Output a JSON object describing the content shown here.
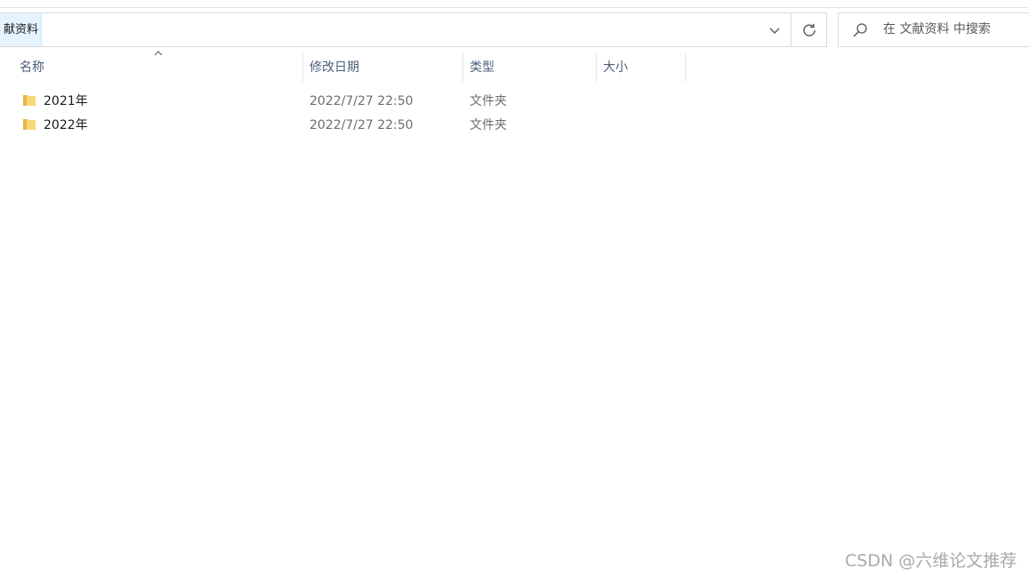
{
  "address_bar": {
    "crumb": "献资料",
    "dropdown_icon": "chevron-down-icon",
    "refresh_icon": "refresh-icon"
  },
  "search": {
    "placeholder": "在 文献资料 中搜索",
    "icon": "search-icon"
  },
  "columns": {
    "name": "名称",
    "date_modified": "修改日期",
    "type": "类型",
    "size": "大小"
  },
  "files": [
    {
      "name": "2021年",
      "date_modified": "2022/7/27 22:50",
      "type": "文件夹",
      "size": ""
    },
    {
      "name": "2022年",
      "date_modified": "2022/7/27 22:50",
      "type": "文件夹",
      "size": ""
    }
  ],
  "watermark": "CSDN @六维论文推荐",
  "colors": {
    "crumb_bg": "#e5f3ff",
    "header_text": "#4c607a",
    "folder_yellow": "#f8d775"
  }
}
